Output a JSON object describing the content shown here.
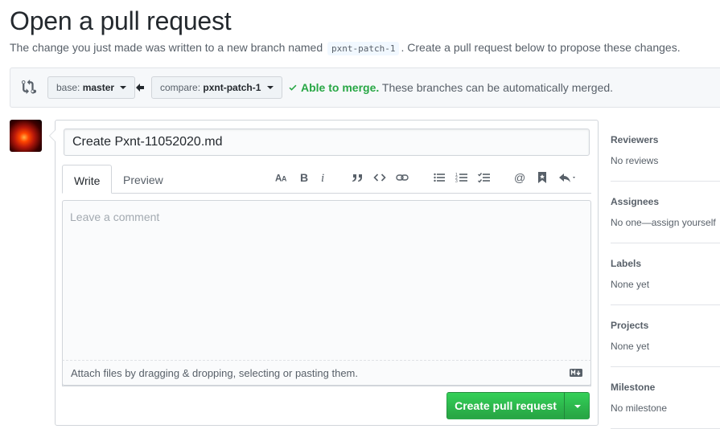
{
  "page": {
    "title": "Open a pull request",
    "subtitle_before": "The change you just made was written to a new branch named",
    "branch_name": "pxnt-patch-1",
    "subtitle_after": ". Create a pull request below to propose these changes."
  },
  "range": {
    "base_label": "base:",
    "base_value": "master",
    "compare_label": "compare:",
    "compare_value": "pxnt-patch-1",
    "merge_ok": "Able to merge.",
    "merge_text": "These branches can be automatically merged."
  },
  "composer": {
    "title_value": "Create Pxnt-11052020.md",
    "tabs": [
      {
        "label": "Write",
        "active": true
      },
      {
        "label": "Preview",
        "active": false
      }
    ],
    "toolbar_icons": [
      "text-size-icon",
      "bold-icon",
      "italic-icon",
      "quote-icon",
      "code-icon",
      "link-icon",
      "bullet-list-icon",
      "numbered-list-icon",
      "task-list-icon",
      "mention-icon",
      "saved-reply-icon",
      "reply-icon"
    ],
    "comment_placeholder": "Leave a comment",
    "attach_text": "Attach files by dragging & dropping, selecting or pasting them.",
    "submit_label": "Create pull request"
  },
  "sidebar": {
    "sections": [
      {
        "heading": "Reviewers",
        "value": "No reviews"
      },
      {
        "heading": "Assignees",
        "value": "No one—assign yourself"
      },
      {
        "heading": "Labels",
        "value": "None yet"
      },
      {
        "heading": "Projects",
        "value": "None yet"
      },
      {
        "heading": "Milestone",
        "value": "No milestone"
      }
    ]
  },
  "colors": {
    "accent_green": "#28a745",
    "text": "#24292e",
    "muted": "#586069",
    "border": "#d1d5da"
  }
}
